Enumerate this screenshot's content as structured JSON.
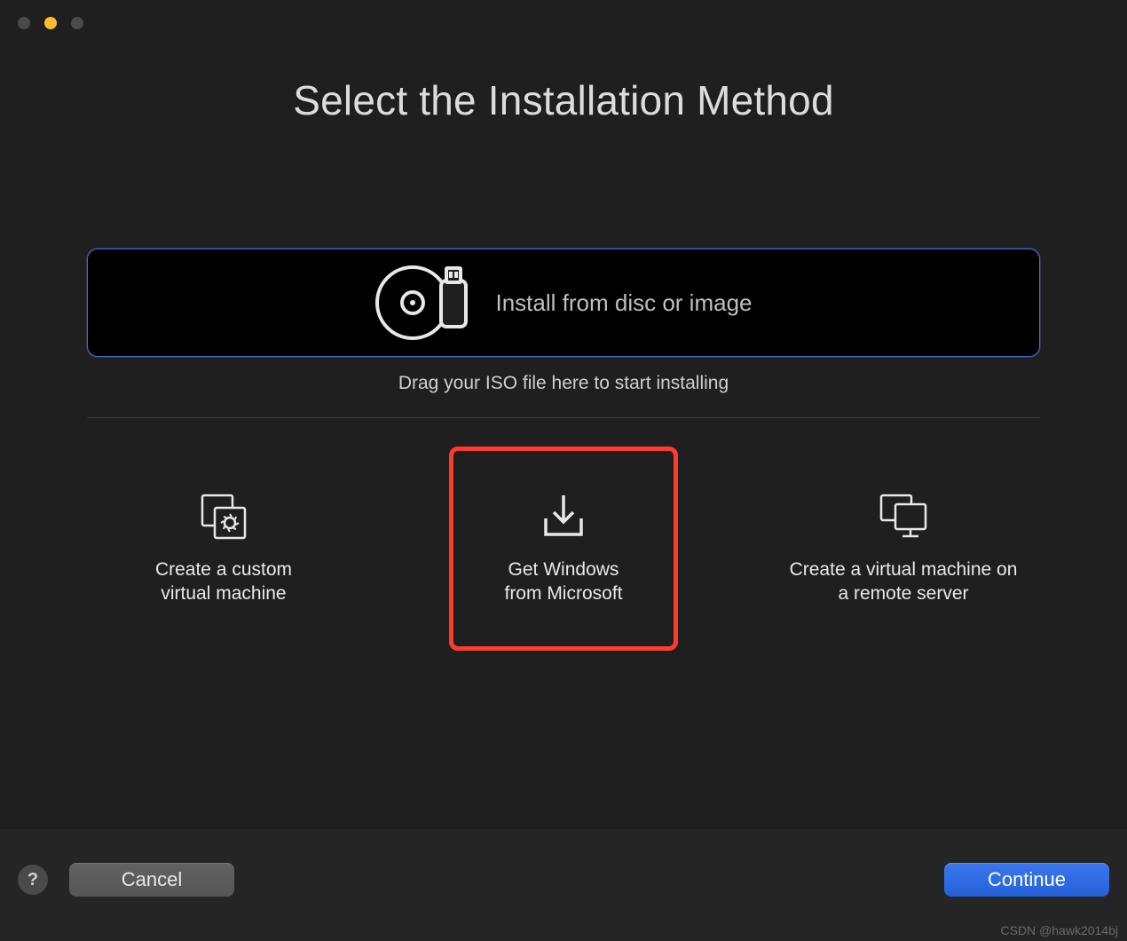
{
  "title": "Select the Installation Method",
  "drop_zone": {
    "label": "Install from disc or image",
    "hint": "Drag your ISO file here to start installing"
  },
  "options": {
    "custom": "Create a custom\nvirtual machine",
    "windows": "Get Windows\nfrom Microsoft",
    "remote": "Create a virtual machine on\na remote server"
  },
  "footer": {
    "help": "?",
    "cancel": "Cancel",
    "continue": "Continue"
  },
  "watermark": "CSDN @hawk2014bj"
}
